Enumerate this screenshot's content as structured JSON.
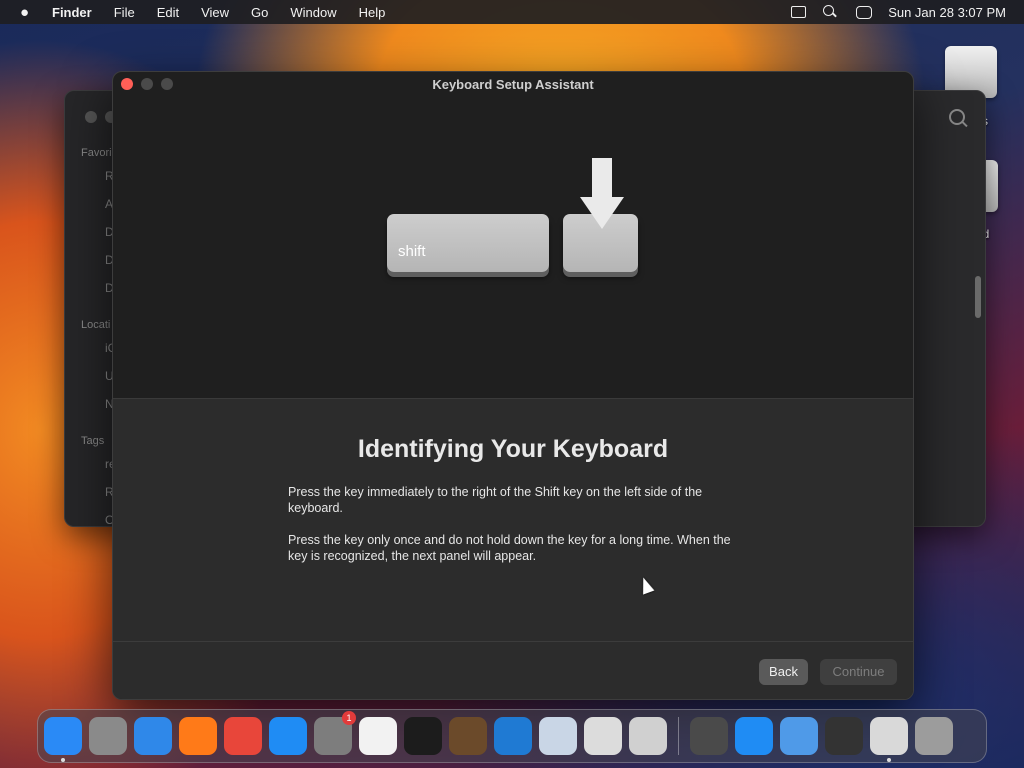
{
  "menubar": {
    "apple_icon": "apple-icon",
    "app_name": "Finder",
    "items": [
      "File",
      "Edit",
      "View",
      "Go",
      "Window",
      "Help"
    ],
    "datetime": "Sun Jan 28  3:07 PM"
  },
  "desktop": {
    "disk_labels": [
      "s",
      "ed"
    ]
  },
  "finder": {
    "sections": [
      "Favori",
      "Locati",
      "Tags"
    ],
    "favorites": [
      "R",
      "A",
      "D",
      "D",
      "D"
    ],
    "locations": [
      "iC",
      "U",
      "N"
    ],
    "tags": [
      "re",
      "R",
      "O"
    ]
  },
  "dialog": {
    "title": "Keyboard Setup Assistant",
    "key_label": "shift",
    "heading": "Identifying Your Keyboard",
    "paragraph1": "Press the key immediately to the right of the Shift key on the left side of the keyboard.",
    "paragraph2": "Press the key only once and do not hold down the key for a long time. When the key is recognized, the next panel will appear.",
    "back_label": "Back",
    "continue_label": "Continue"
  },
  "dock": {
    "items": [
      {
        "name": "finder-icon",
        "color": "#2a8af6",
        "running": true
      },
      {
        "name": "launchpad-icon",
        "color": "#8a8a8a"
      },
      {
        "name": "safari-icon",
        "color": "#2f88e9"
      },
      {
        "name": "firefox-icon",
        "color": "#ff7a18"
      },
      {
        "name": "chrome-icon",
        "color": "#e8463a"
      },
      {
        "name": "app-store-icon",
        "color": "#1f8cf4"
      },
      {
        "name": "system-settings-icon",
        "color": "#7d7d7d",
        "badge": "1"
      },
      {
        "name": "textedit-icon",
        "color": "#f2f2f2"
      },
      {
        "name": "terminal-icon",
        "color": "#1c1c1c"
      },
      {
        "name": "instruments-icon",
        "color": "#6b4a2a"
      },
      {
        "name": "vscode-icon",
        "color": "#1f7ad3"
      },
      {
        "name": "preview-icon",
        "color": "#c9d6e6"
      },
      {
        "name": "disk-utility-icon",
        "color": "#dcdcdc"
      },
      {
        "name": "migration-assistant-icon",
        "color": "#d0d0d0"
      }
    ],
    "right_items": [
      {
        "name": "chess-icon",
        "color": "#4a4a4a"
      },
      {
        "name": "xcode-instruments-icon",
        "color": "#1f8cf4"
      },
      {
        "name": "finder-alt-icon",
        "color": "#4f9ae8"
      },
      {
        "name": "tuxedo-icon",
        "color": "#333333"
      },
      {
        "name": "downloads-icon",
        "color": "#d9d9d9",
        "running": true
      },
      {
        "name": "trash-icon",
        "color": "#9c9c9c"
      }
    ]
  }
}
